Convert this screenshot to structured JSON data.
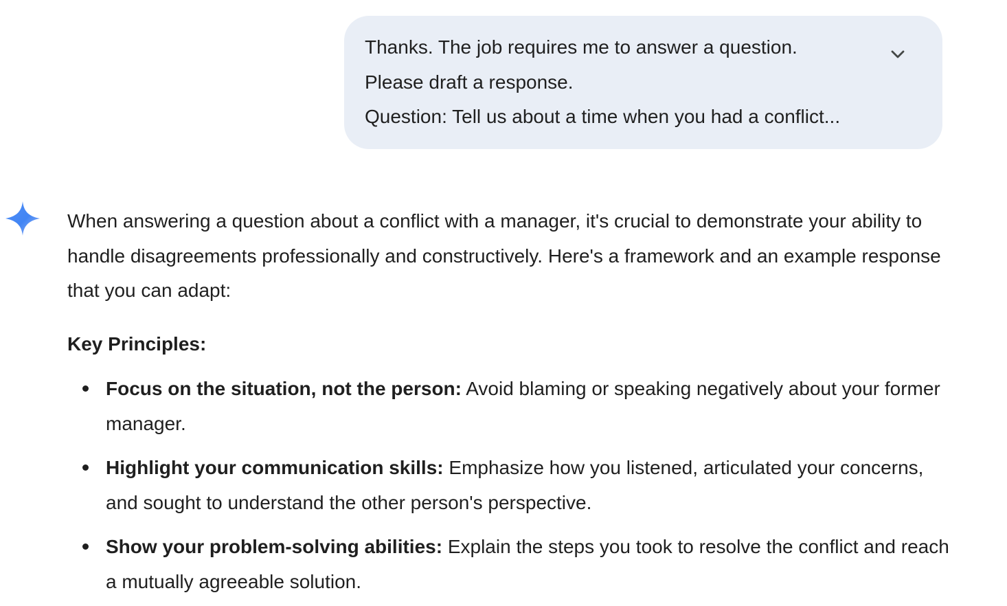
{
  "user_message": {
    "lines": [
      "Thanks. The job requires me to answer a question.",
      "Please draft a response.",
      "Question: Tell us about a time when you had a conflict..."
    ],
    "expand_icon": "chevron-down-icon"
  },
  "response": {
    "avatar_icon": "gemini-spark-icon",
    "intro": "When answering a question about a conflict with a manager, it's crucial to demonstrate your ability to handle disagreements professionally and constructively. Here's a framework and an example response that you can adapt:",
    "heading": "Key Principles:",
    "principles": [
      {
        "title": "Focus on the situation, not the person:",
        "text": " Avoid blaming or speaking negatively about your former manager."
      },
      {
        "title": "Highlight your communication skills:",
        "text": " Emphasize how you listened, articulated your concerns, and sought to understand the other person's perspective."
      },
      {
        "title": "Show your problem-solving abilities:",
        "text": " Explain the steps you took to resolve the conflict and reach a mutually agreeable solution."
      }
    ]
  },
  "colors": {
    "bubble_bg": "#e9eef6",
    "text": "#1f1f1f",
    "spark_blue": "#4285f4",
    "spark_light": "#8ab4f8"
  }
}
